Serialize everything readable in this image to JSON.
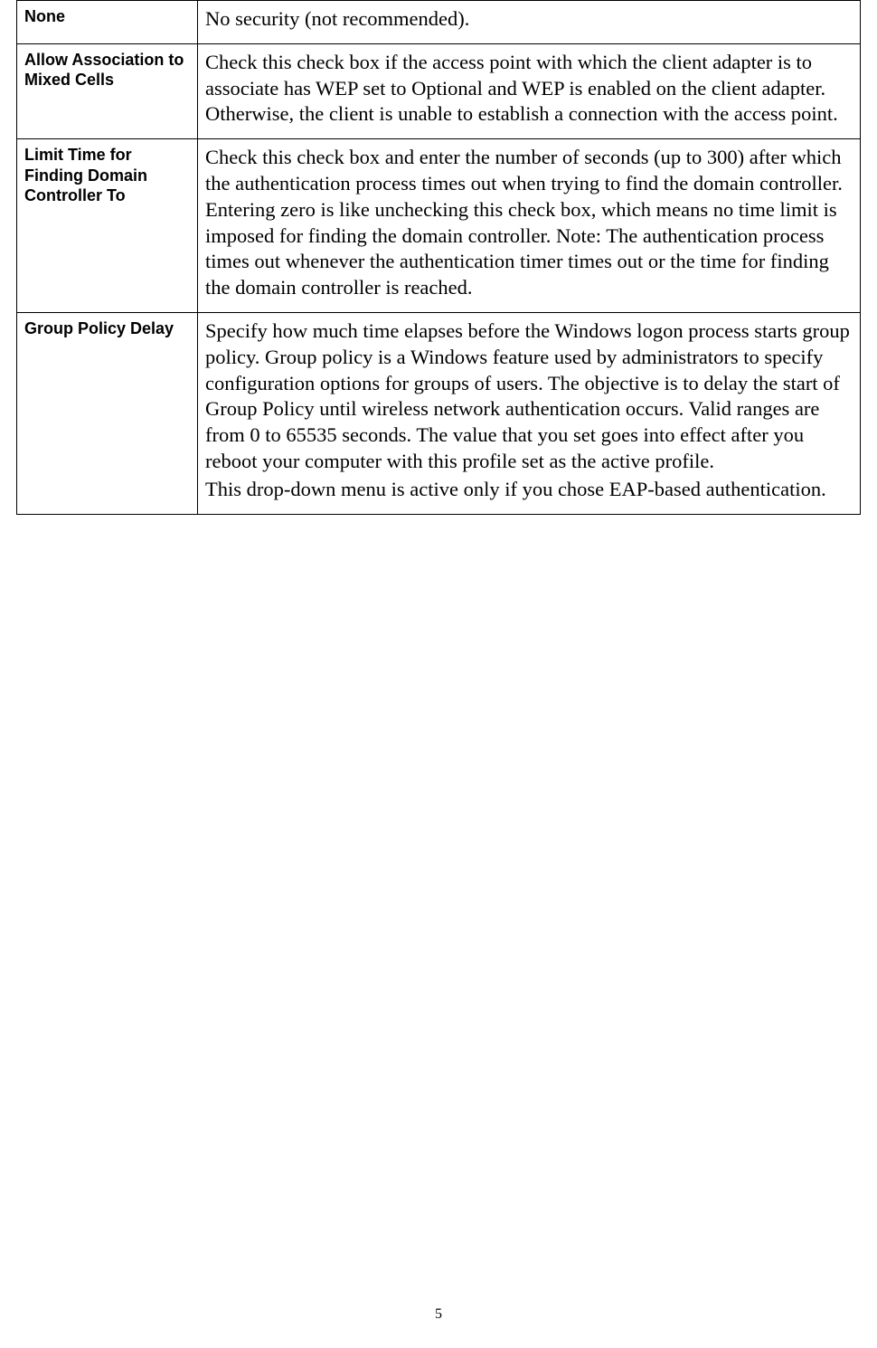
{
  "rows": [
    {
      "label": "None",
      "desc": [
        "No security (not recommended)."
      ]
    },
    {
      "label": "Allow Association to Mixed Cells",
      "desc": [
        "Check this check box if the access point with which the client adapter is to associate has WEP set to Optional and WEP is enabled on the client adapter. Otherwise, the client is unable to establish a connection with the access point."
      ]
    },
    {
      "label": "Limit Time for Finding Domain Controller To",
      "desc": [
        "Check this check box and enter the number of seconds (up to 300) after which the authentication process times out when trying to find the domain controller. Entering zero is like unchecking this check box, which means no time limit is imposed for finding the domain controller. Note: The authentication process times out whenever the authentication timer times out or the time for finding the domain controller is reached."
      ]
    },
    {
      "label": "Group Policy Delay",
      "desc": [
        "Specify how much time elapses before the Windows logon process starts group policy. Group policy is a Windows feature used by administrators to specify configuration options for groups of users. The objective is to delay the start of Group Policy until wireless network authentication occurs. Valid ranges are from 0 to 65535 seconds. The value that you set goes into effect after you reboot your computer with this profile set as the active profile.",
        "This drop-down menu is active only if you chose EAP-based authentication."
      ]
    }
  ],
  "page_number": "5"
}
